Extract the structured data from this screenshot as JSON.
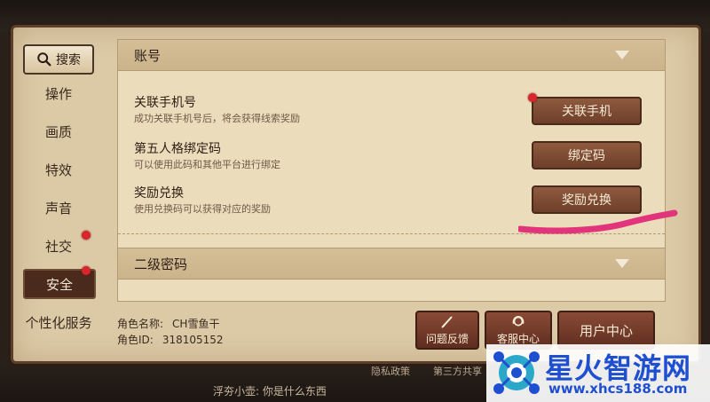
{
  "sidebar": {
    "search_label": "搜索",
    "items": [
      {
        "label": "操作"
      },
      {
        "label": "画质"
      },
      {
        "label": "特效"
      },
      {
        "label": "声音"
      },
      {
        "label": "社交"
      },
      {
        "label": "安全"
      },
      {
        "label": "个性化服务"
      }
    ]
  },
  "account": {
    "section_title": "账号",
    "rows": [
      {
        "title": "关联手机号",
        "desc": "成功关联手机号后，将会获得线索奖励",
        "button": "关联手机"
      },
      {
        "title": "第五人格绑定码",
        "desc": "可以使用此码和其他平台进行绑定",
        "button": "绑定码"
      },
      {
        "title": "奖励兑换",
        "desc": "使用兑换码可以获得对应的奖励",
        "button": "奖励兑换"
      }
    ]
  },
  "second_password": {
    "section_title": "二级密码"
  },
  "role": {
    "name_label": "角色名称:",
    "name_value": "CH雪鱼干",
    "id_label": "角色ID:",
    "id_value": "318105152"
  },
  "bottom_buttons": {
    "feedback": "问题反馈",
    "customer_service": "客服中心",
    "user_center": "用户中心"
  },
  "footer": {
    "privacy": "隐私政策",
    "third_party": "第三方共享",
    "chat": "浮夯小壶: 你是什么东西"
  },
  "watermark": {
    "title": "星火智游网",
    "url": "www.xhcs188.com"
  },
  "colors": {
    "panel_bg": "#dcc9a6",
    "button_brown": "#7b4a33",
    "dark_accent": "#4a2a1c",
    "alert_red": "#d9252b",
    "highlight_pink": "#e2347a",
    "watermark_blue": "#1f4fd1"
  }
}
